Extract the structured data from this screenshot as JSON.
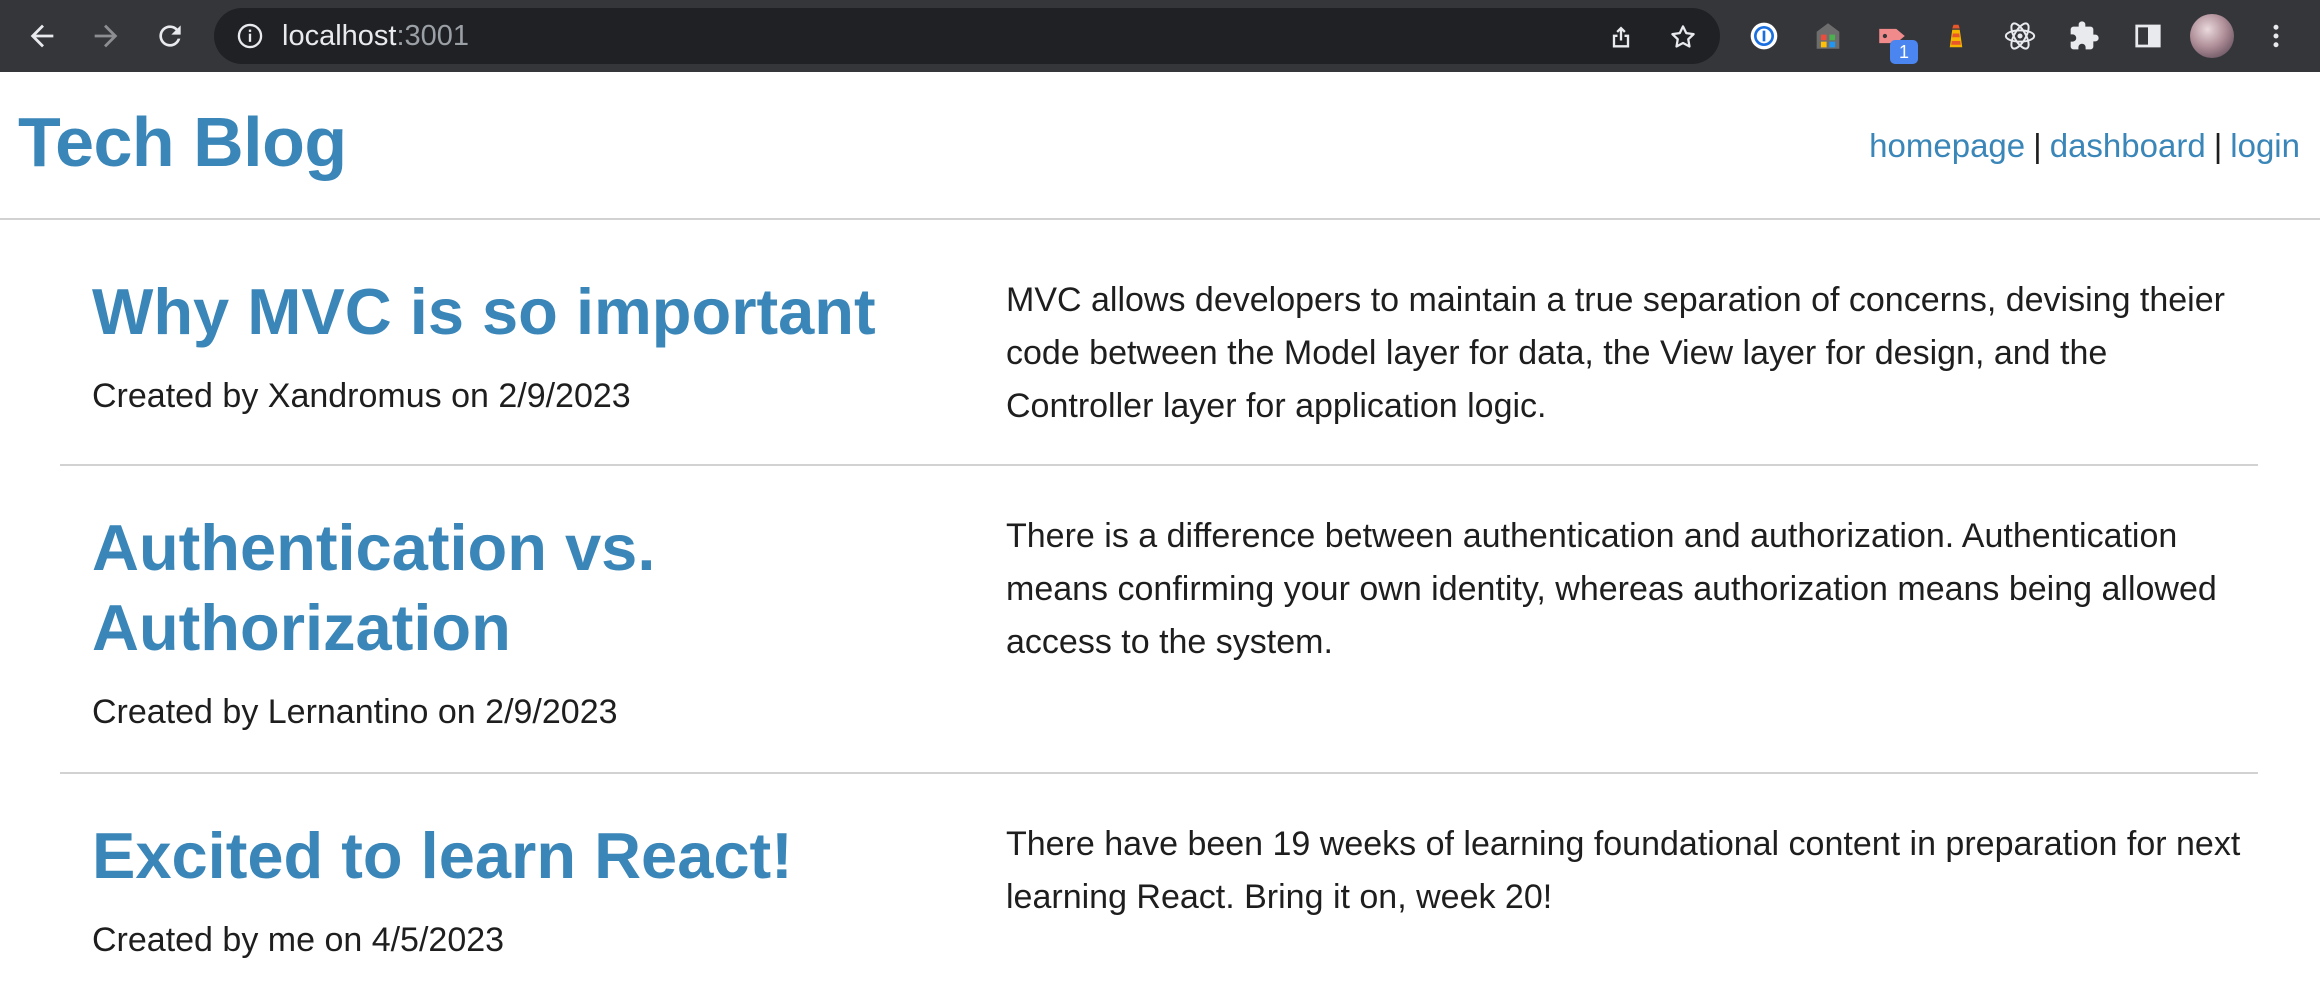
{
  "browser": {
    "url_host": "localhost",
    "url_port": ":3001",
    "extension_badge": "1",
    "icons": [
      "back-icon",
      "forward-icon",
      "reload-icon",
      "info-icon",
      "share-icon",
      "bookmark-star-icon",
      "password-manager-icon",
      "extension-icon",
      "puzzle-icon",
      "side-panel-icon",
      "menu-icon"
    ]
  },
  "site": {
    "title": "Tech Blog",
    "nav": {
      "homepage": "homepage",
      "separator": "|",
      "dashboard": "dashboard",
      "login": "login"
    },
    "accent_color": "#3a86b8"
  },
  "posts": [
    {
      "title": "Why MVC is so important",
      "meta": "Created by Xandromus on 2/9/2023",
      "body": "MVC allows developers to maintain a true separation of concerns, devising theier code between the Model layer for data, the View layer for design, and the Controller layer for application logic."
    },
    {
      "title": "Authentication vs. Authorization",
      "meta": "Created by Lernantino on 2/9/2023",
      "body": "There is a difference between authentication and authorization. Authentication means confirming your own identity, whereas authorization means being allowed access to the system."
    },
    {
      "title": "Excited to learn React!",
      "meta": "Created by me on 4/5/2023",
      "body": "There have been 19 weeks of learning foundational content in preparation for next learning React. Bring it on, week 20!"
    }
  ]
}
